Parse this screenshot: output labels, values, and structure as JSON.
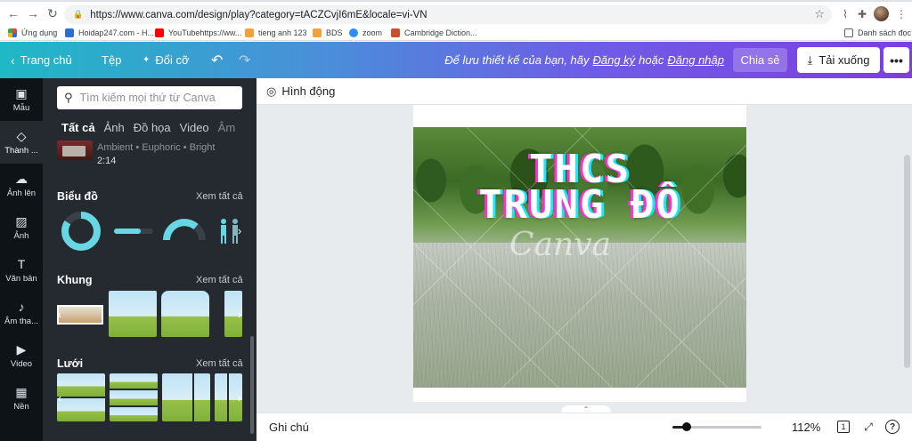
{
  "browser": {
    "url": "https://www.canva.com/design/play?category=tACZCvjI6mE&locale=vi-VN",
    "bookmarks": [
      {
        "label": "Ứng dụng",
        "color": "#e0463a"
      },
      {
        "label": "Hoidap247.com - H...",
        "color": "#2b6fd6"
      },
      {
        "label": "YouTubehttps://ww...",
        "color": "#ff0000"
      },
      {
        "label": "tieng anh 123",
        "color": "#f2a23a"
      },
      {
        "label": "BDS",
        "color": "#f2a23a"
      },
      {
        "label": "zoom",
        "color": "#2d8cff"
      },
      {
        "label": "Cambridge Diction...",
        "color": "#c8512a"
      },
      {
        "label": "Danh sách đọc",
        "color": "#5f6368"
      }
    ]
  },
  "topbar": {
    "home": "Trang chủ",
    "file": "Tệp",
    "resize": "Đổi cỡ",
    "save_prefix": "Để lưu thiết kế của bạn, hãy",
    "signup": "Đăng ký",
    "or": "hoặc",
    "login": "Đăng nhập",
    "share": "Chia sẻ",
    "download": "Tải xuống",
    "more": "•••"
  },
  "rail": {
    "items": [
      {
        "label": "Mẫu",
        "icon": "▣"
      },
      {
        "label": "Thành ...",
        "icon": "◇"
      },
      {
        "label": "Ảnh lên",
        "icon": "☁"
      },
      {
        "label": "Ảnh",
        "icon": "▨"
      },
      {
        "label": "Văn bản",
        "icon": "T"
      },
      {
        "label": "Âm tha...",
        "icon": "♪"
      },
      {
        "label": "Video",
        "icon": "▶"
      },
      {
        "label": "Nền",
        "icon": "▦"
      }
    ]
  },
  "panel": {
    "search_placeholder": "Tìm kiếm mọi thứ từ Canva",
    "tabs": [
      "Tất cả",
      "Ảnh",
      "Đồ họa",
      "Video",
      "Âm"
    ],
    "audio": {
      "meta": "Ambient • Euphoric • Bright",
      "duration": "2:14"
    },
    "sections": {
      "charts": {
        "title": "Biểu đồ",
        "link": "Xem tất cả"
      },
      "frames": {
        "title": "Khung",
        "link": "Xem tất cả"
      },
      "grids": {
        "title": "Lưới",
        "link": "Xem tất cả"
      }
    },
    "accent": "#67d7e4"
  },
  "workspace": {
    "toolbar_label": "Hình động",
    "design": {
      "line1": "THCS",
      "line2": "TRUNG ĐÔ",
      "watermark": "Canva"
    }
  },
  "statusbar": {
    "notes": "Ghi chú",
    "zoom_value": "112%",
    "zoom_fraction": 0.16,
    "page_count": "1"
  }
}
